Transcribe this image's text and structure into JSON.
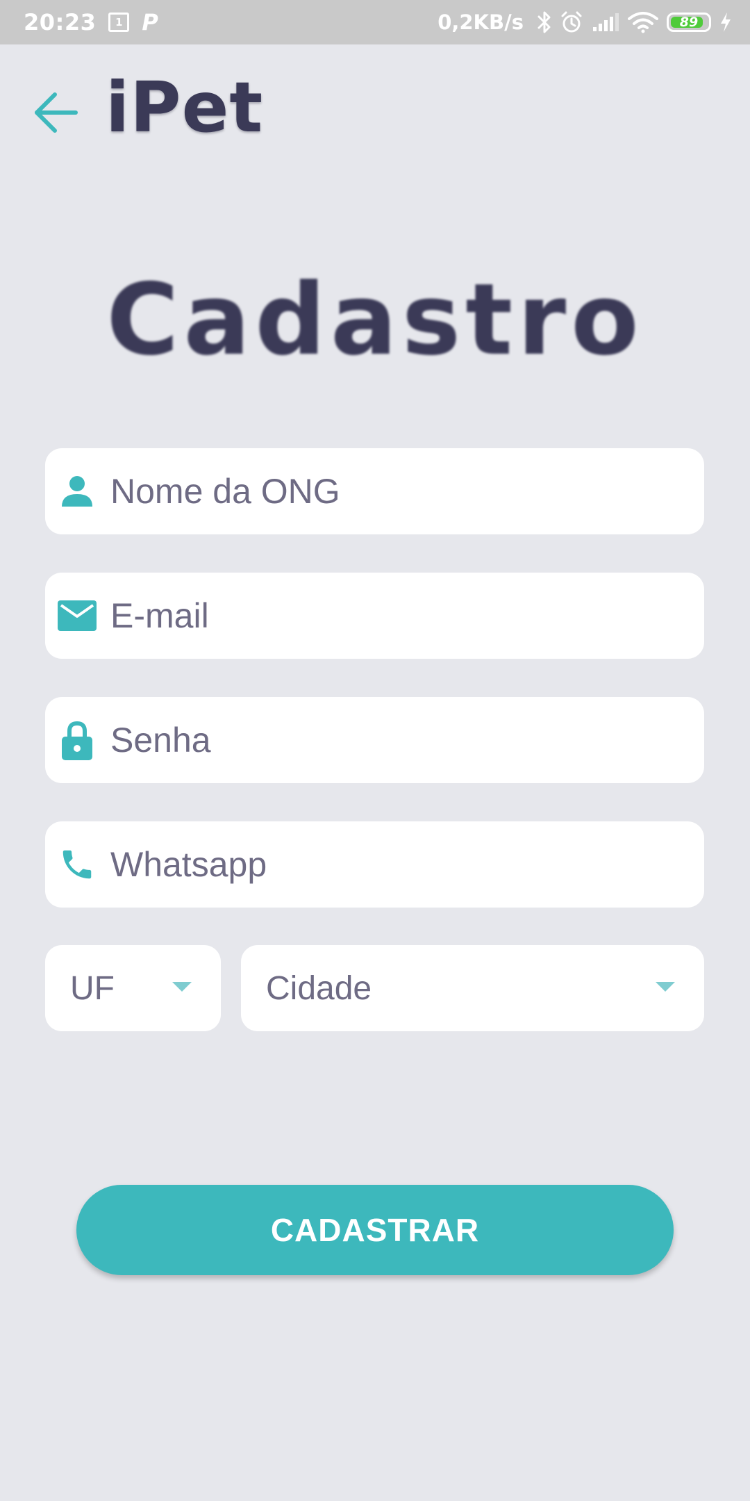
{
  "status_bar": {
    "time": "20:23",
    "notification_box_text": "1",
    "notification_app_letter": "P",
    "network_speed": "0,2KB/s",
    "battery_level": "89",
    "battery_fraction": 0.89,
    "icons": [
      "sim-notification-icon",
      "p-app-icon",
      "bluetooth-icon",
      "alarm-icon",
      "signal-icon",
      "wifi-icon",
      "battery-icon",
      "charging-icon"
    ]
  },
  "header": {
    "back_icon": "arrow-left-icon",
    "app_title": "iPet"
  },
  "page": {
    "heading": "Cadastro"
  },
  "form": {
    "ong_name": {
      "placeholder": "Nome da ONG",
      "value": "",
      "icon": "person-icon"
    },
    "email": {
      "placeholder": "E-mail",
      "value": "",
      "icon": "envelope-icon"
    },
    "password": {
      "placeholder": "Senha",
      "value": "",
      "icon": "lock-icon"
    },
    "whatsapp": {
      "placeholder": "Whatsapp",
      "value": "",
      "icon": "phone-icon"
    },
    "uf": {
      "selected": "UF",
      "icon": "caret-down-icon"
    },
    "city": {
      "selected": "Cidade",
      "icon": "caret-down-icon"
    },
    "submit_label": "CADASTRAR"
  },
  "colors": {
    "accent": "#3DB8BC",
    "background": "#E6E7EC",
    "title": "#3B3A57",
    "placeholder": "#6E6B84",
    "field_background": "#FFFFFF",
    "status_bar": "#C9C9C9",
    "battery_fill": "#4FCB3A"
  }
}
